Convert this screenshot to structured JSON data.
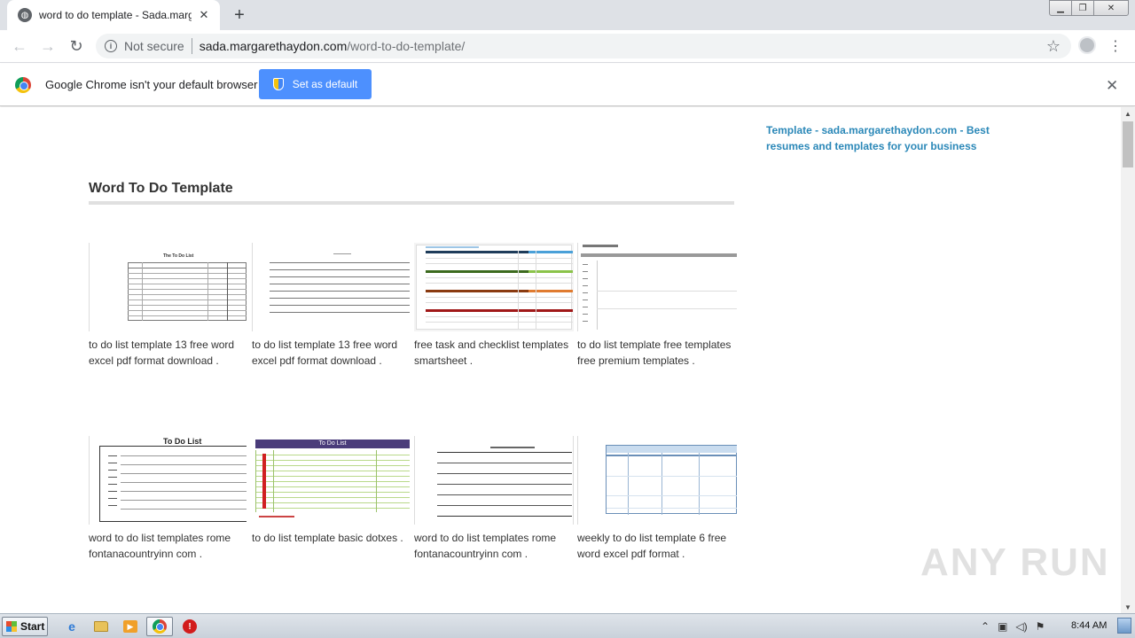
{
  "browser": {
    "tab_title": "word to do template - Sada.margarethaydon.com",
    "new_tab_symbol": "+",
    "tab_close_symbol": "✕",
    "window_controls": {
      "minimize": "▁",
      "maximize": "❐",
      "close": "✕"
    },
    "security_label": "Not secure",
    "url_host": "sada.margarethaydon.com",
    "url_path": "/word-to-do-template/",
    "back_symbol": "←",
    "forward_symbol": "→",
    "reload_symbol": "↻",
    "star_symbol": "☆",
    "menu_symbol": "⋮"
  },
  "infobar": {
    "message": "Google Chrome isn't your default browser",
    "button_label": "Set as default",
    "close_symbol": "✕"
  },
  "page": {
    "sidebar_link": "Template - sada.margarethaydon.com - Best resumes and templates for your business",
    "title": "Word To Do Template",
    "cards": [
      {
        "caption": "to do list template 13 free word excel pdf format download ."
      },
      {
        "caption": "to do list template 13 free word excel pdf format download ."
      },
      {
        "caption": "free task and checklist templates smartsheet ."
      },
      {
        "caption": "to do list template free templates free premium templates ."
      },
      {
        "caption": "word to do list templates rome fontanacountryinn com ."
      },
      {
        "caption": "to do list template basic dotxes ."
      },
      {
        "caption": "word to do list templates rome fontanacountryinn com ."
      },
      {
        "caption": "weekly to do list template 6 free word excel pdf format ."
      }
    ],
    "thumb_texts": {
      "t1_heading": "The To Do List",
      "t5_heading": "To Do List",
      "t6_heading": "To Do List"
    }
  },
  "watermark": "ANY RUN",
  "taskbar": {
    "start_label": "Start",
    "clock": "8:44 AM",
    "ie_symbol": "e",
    "media_symbol": "▶",
    "stop_symbol": "!"
  },
  "scrollbar": {
    "up_symbol": "▲",
    "down_symbol": "▼"
  },
  "icons": {
    "tab_favicon": "globe-icon",
    "info": "info-icon",
    "star": "star-icon",
    "profile": "profile-icon",
    "menu": "kebab-menu-icon",
    "chrome_logo": "chrome-logo-icon",
    "shield": "uac-shield-icon"
  },
  "colors": {
    "sidebar_link": "#2b88b8",
    "set_default_button": "#4d90fe",
    "tab_strip": "#dee1e6"
  }
}
